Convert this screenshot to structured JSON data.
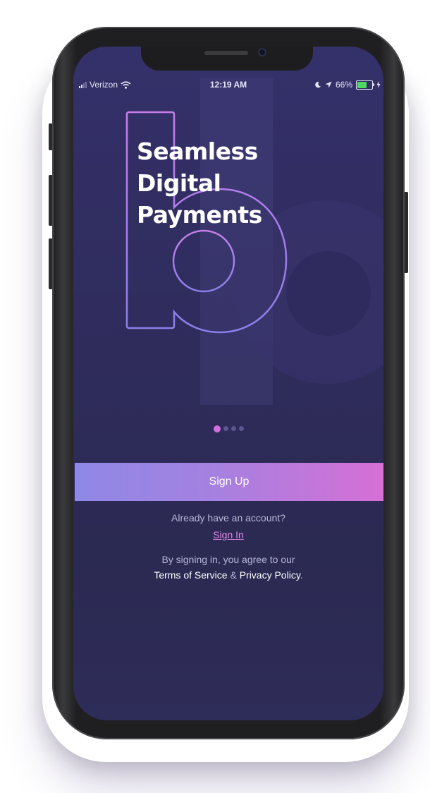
{
  "status_bar": {
    "carrier": "Verizon",
    "time": "12:19 AM",
    "battery": "66%",
    "battery_level": 0.66
  },
  "hero": {
    "headline_lines": [
      "Seamless",
      "Digital",
      "Payments"
    ]
  },
  "pager": {
    "total": 4,
    "active_index": 0
  },
  "actions": {
    "signup_label": "Sign Up",
    "already_text": "Already have an account?",
    "signin_label": "Sign In"
  },
  "legal": {
    "line1": "By signing in, you agree to our",
    "terms_label": "Terms of Service",
    "ampersand": "&",
    "privacy_label": "Privacy Policy",
    "period": "."
  },
  "colors": {
    "accent_pink": "#d46ee0",
    "button_start": "#8f88e6",
    "button_end": "#d66fd6",
    "background": "#2f2c5c",
    "battery_green": "#4cd964"
  },
  "icons": [
    "wifi-icon",
    "moon-icon",
    "location-arrow-icon",
    "battery-icon",
    "charging-icon"
  ]
}
